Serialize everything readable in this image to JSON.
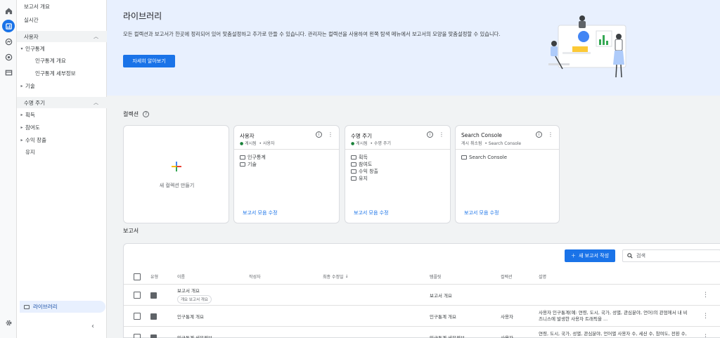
{
  "nav": {
    "top_items": [
      "보고서 개요",
      "실시간"
    ],
    "section_users": "사용자",
    "users_items": [
      "인구통계",
      "인구통계 개요",
      "인구통계 세부정보",
      "기술"
    ],
    "section_lifecycle": "수명 주기",
    "lifecycle_items": [
      "획득",
      "참여도",
      "수익 창출",
      "유지"
    ],
    "library": "라이브러리"
  },
  "hero": {
    "title": "라이브러리",
    "description": "모든 컬렉션과 보고서가 한곳에 정리되어 있어 맞춤설정하고 추가로 만들 수 있습니다. 관리자는 컬렉션을 사용하여 왼쪽 탐색 메뉴에서 보고서의 모양을 맞춤설정할 수 있습니다.",
    "button": "자세히 알아보기"
  },
  "collections": {
    "title": "컬렉션",
    "new_label": "새 컬렉션 만들기",
    "cards": [
      {
        "title": "사용자",
        "meta_published": "게시됨",
        "meta_type": "사용자",
        "items": [
          "인구통계",
          "기술"
        ],
        "link": "보고서 모음 수정"
      },
      {
        "title": "수명 주기",
        "meta_published": "게시됨",
        "meta_type": "수명 주기",
        "items": [
          "획득",
          "참여도",
          "수익 창출",
          "유지"
        ],
        "link": "보고서 모음 수정"
      },
      {
        "title": "Search Console",
        "meta_published": "게시 취소됨",
        "meta_type": "Search Console",
        "items": [
          "Search Console"
        ],
        "link": "보고서 모음 수정"
      }
    ]
  },
  "reports": {
    "title": "보고서",
    "new_button": "새 보고서 작성",
    "search_placeholder": "검색",
    "columns": [
      "유형",
      "이름",
      "작성자",
      "최종 수정일",
      "템플릿",
      "컬렉션",
      "설명"
    ],
    "rows": [
      {
        "name": "보고서 개요",
        "chip": "개요 보고서 개요",
        "template": "보고서 개요",
        "collection": "",
        "description": ""
      },
      {
        "name": "인구통계 개요",
        "chip": "",
        "template": "인구통계 개요",
        "collection": "사용자",
        "description": "사용자 인구통계(예: 연령, 도시, 국가, 성별, 관심분야, 언어)의 관점에서 내 비즈니스에 발생한 사용자 트래픽을 ..."
      },
      {
        "name": "인구통계 세부정보",
        "chip": "",
        "template": "인구통계 세부정보",
        "collection": "사용자",
        "description": "연령, 도시, 국가, 성별, 관심분야, 언어별 사용자 수, 세션 수, 참여도, 전환 수, 주요 이벤트 및 매출 등 ..."
      }
    ]
  },
  "colors": {
    "accent": "#1a73e8",
    "hero_bg": "#e8f0fe",
    "page_bg": "#f1f3f4"
  }
}
